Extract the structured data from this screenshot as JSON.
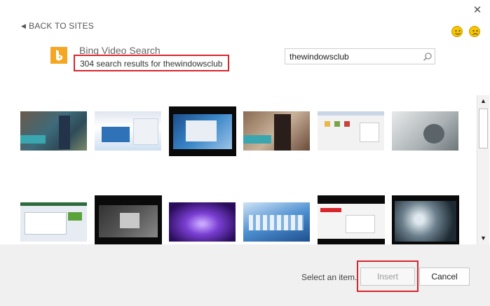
{
  "nav": {
    "back_label": "BACK TO SITES"
  },
  "feedback": {
    "happy_icon": "smiley-happy-icon",
    "sad_icon": "smiley-sad-icon"
  },
  "source": {
    "icon": "bing-logo-icon",
    "title": "Bing Video Search",
    "results": "304 search results for thewindowsclub"
  },
  "search": {
    "value": "thewindowsclub",
    "placeholder": ""
  },
  "footer": {
    "status": "Select an item.",
    "insert_label": "Insert",
    "cancel_label": "Cancel"
  },
  "colors": {
    "highlight": "#d7262e",
    "bing_orange": "#f5a623"
  }
}
